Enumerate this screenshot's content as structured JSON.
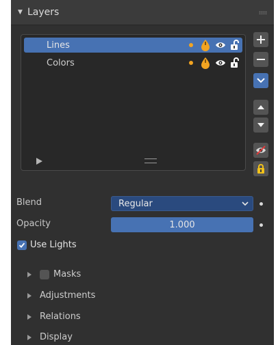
{
  "panel": {
    "title": "Layers",
    "collapse_icon": "triangle-down-icon"
  },
  "layers": {
    "items": [
      {
        "label": "Lines",
        "selected": true
      },
      {
        "label": "Colors",
        "selected": false
      }
    ],
    "row_icons": [
      "dot-icon",
      "onion-skin-drop-icon",
      "eye-icon",
      "lock-icon"
    ]
  },
  "side_buttons": [
    "add-icon",
    "remove-icon",
    "menu-chevron-icon",
    "move-up-icon",
    "move-down-icon",
    "hide-others-icon",
    "lock-others-icon"
  ],
  "properties": {
    "blend_label": "Blend",
    "blend_value": "Regular",
    "opacity_label": "Opacity",
    "opacity_value": "1.000",
    "use_lights_label": "Use Lights",
    "use_lights_checked": true
  },
  "subpanels": [
    {
      "label": "Masks",
      "has_checkbox": true
    },
    {
      "label": "Adjustments",
      "has_checkbox": false
    },
    {
      "label": "Relations",
      "has_checkbox": false
    },
    {
      "label": "Display",
      "has_checkbox": false
    }
  ],
  "colors": {
    "accent": "#4772b3",
    "panel_bg": "#303030",
    "onion_orange": "#f2a421"
  }
}
